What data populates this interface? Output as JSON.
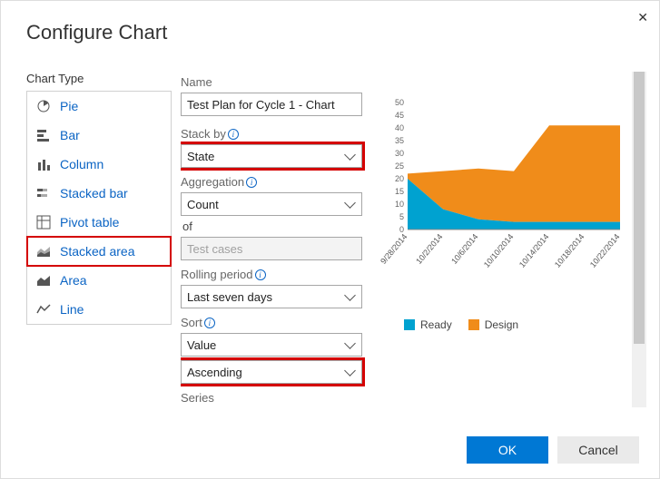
{
  "dialog": {
    "title": "Configure Chart"
  },
  "chartType": {
    "label": "Chart Type",
    "items": [
      {
        "name": "Pie"
      },
      {
        "name": "Bar"
      },
      {
        "name": "Column"
      },
      {
        "name": "Stacked bar"
      },
      {
        "name": "Pivot table"
      },
      {
        "name": "Stacked area"
      },
      {
        "name": "Area"
      },
      {
        "name": "Line"
      }
    ],
    "selected": "Stacked area"
  },
  "fields": {
    "nameLabel": "Name",
    "nameValue": "Test Plan for Cycle 1 - Chart",
    "stackByLabel": "Stack by",
    "stackByValue": "State",
    "aggLabel": "Aggregation",
    "aggValue": "Count",
    "ofLabel": "of",
    "ofValue": "Test cases",
    "rollingLabel": "Rolling period",
    "rollingValue": "Last seven days",
    "sortLabel": "Sort",
    "sortField": "Value",
    "sortDir": "Ascending",
    "seriesLabel": "Series"
  },
  "legend": {
    "series1": "Ready",
    "series2": "Design",
    "color1": "#00a2d0",
    "color2": "#f08c1a"
  },
  "footer": {
    "ok": "OK",
    "cancel": "Cancel"
  },
  "chart_data": {
    "type": "area",
    "title": "",
    "xlabel": "",
    "ylabel": "",
    "ylim": [
      0,
      50
    ],
    "yticks": [
      0,
      5,
      10,
      15,
      20,
      25,
      30,
      35,
      40,
      45,
      50
    ],
    "categories": [
      "9/28/2014",
      "10/2/2014",
      "10/6/2014",
      "10/10/2014",
      "10/14/2014",
      "10/18/2014",
      "10/22/2014"
    ],
    "series": [
      {
        "name": "Ready",
        "color": "#00a2d0",
        "values": [
          20,
          8,
          4,
          3,
          3,
          3,
          3
        ]
      },
      {
        "name": "Design",
        "color": "#f08c1a",
        "values": [
          2,
          15,
          20,
          20,
          38,
          38,
          38
        ]
      }
    ],
    "stacked": true
  }
}
